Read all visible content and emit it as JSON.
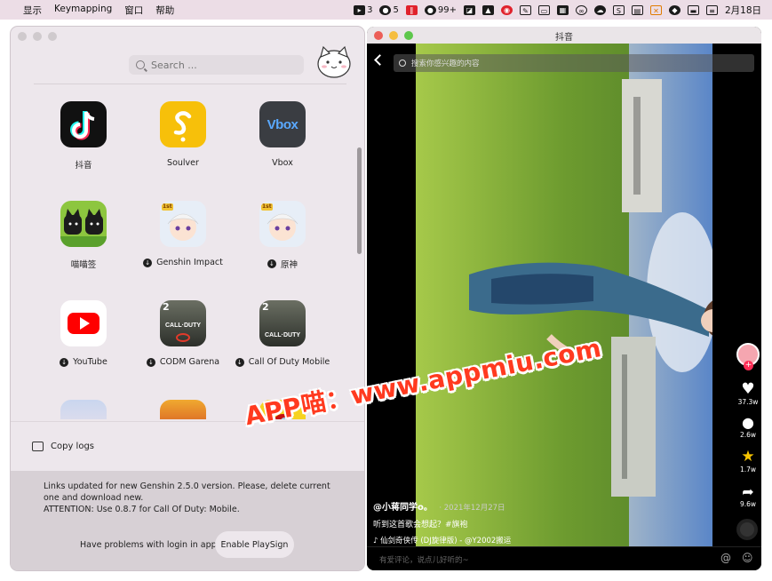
{
  "menubar": {
    "menus": [
      "显示",
      "Keymapping",
      "窗口",
      "帮助"
    ],
    "status": {
      "badge1": "3",
      "wechat_count": "5",
      "qq_count": "99+",
      "date": "2月18日"
    }
  },
  "left_app": {
    "search_placeholder": "Search ...",
    "apps": [
      {
        "name": "抖音",
        "download": false,
        "icon": "tiktok-icon"
      },
      {
        "name": "Soulver",
        "download": false,
        "icon": "soulver-icon"
      },
      {
        "name": "Vbox",
        "download": false,
        "icon": "vbox-icon"
      },
      {
        "name": "喵喵签",
        "download": false,
        "icon": "miaomiaoqian-icon"
      },
      {
        "name": "Genshin Impact",
        "download": true,
        "icon": "genshin-icon"
      },
      {
        "name": "原神",
        "download": true,
        "icon": "yuanshen-icon"
      },
      {
        "name": "YouTube",
        "download": true,
        "icon": "youtube-icon"
      },
      {
        "name": "CODM Garena",
        "download": true,
        "icon": "codm-garena-icon"
      },
      {
        "name": "Call Of Duty Mobile",
        "download": true,
        "icon": "codm-icon"
      }
    ],
    "vbox_text": "Vbox",
    "genshin_badge": "1st",
    "cod_badge": "2",
    "cod_text": "CALL·DUTY",
    "copy_logs": "Copy logs",
    "notice_line1": "Links updated for new Genshin 2.5.0 version. Please, delete current one and download new.",
    "notice_line2": "ATTENTION: Use 0.8.7 for Call Of Duty: Mobile.",
    "problems_text": "Have problems with login in apps?",
    "enable_button": "Enable PlaySign"
  },
  "douyin": {
    "window_title": "抖音",
    "search_placeholder": "搜索你感兴趣的内容",
    "likes": "37.3w",
    "comments": "2.6w",
    "favorites": "1.7w",
    "shares": "9.6w",
    "author": "@小蒋同学o。",
    "date": "· 2021年12月27日",
    "caption": "听到这首歌会想起？#旗袍",
    "music": "♪ 仙剑奇侠传 (DJ旋律版) - @Y2002搬运",
    "comment_placeholder": "有爱评论，说点儿好听的~"
  },
  "watermark": "APP喵：www.appmiu.com",
  "colors": {
    "accent_red": "#fe2c55",
    "watermark_red": "#ff3a1f",
    "panel_bg": "#ede7ec"
  }
}
